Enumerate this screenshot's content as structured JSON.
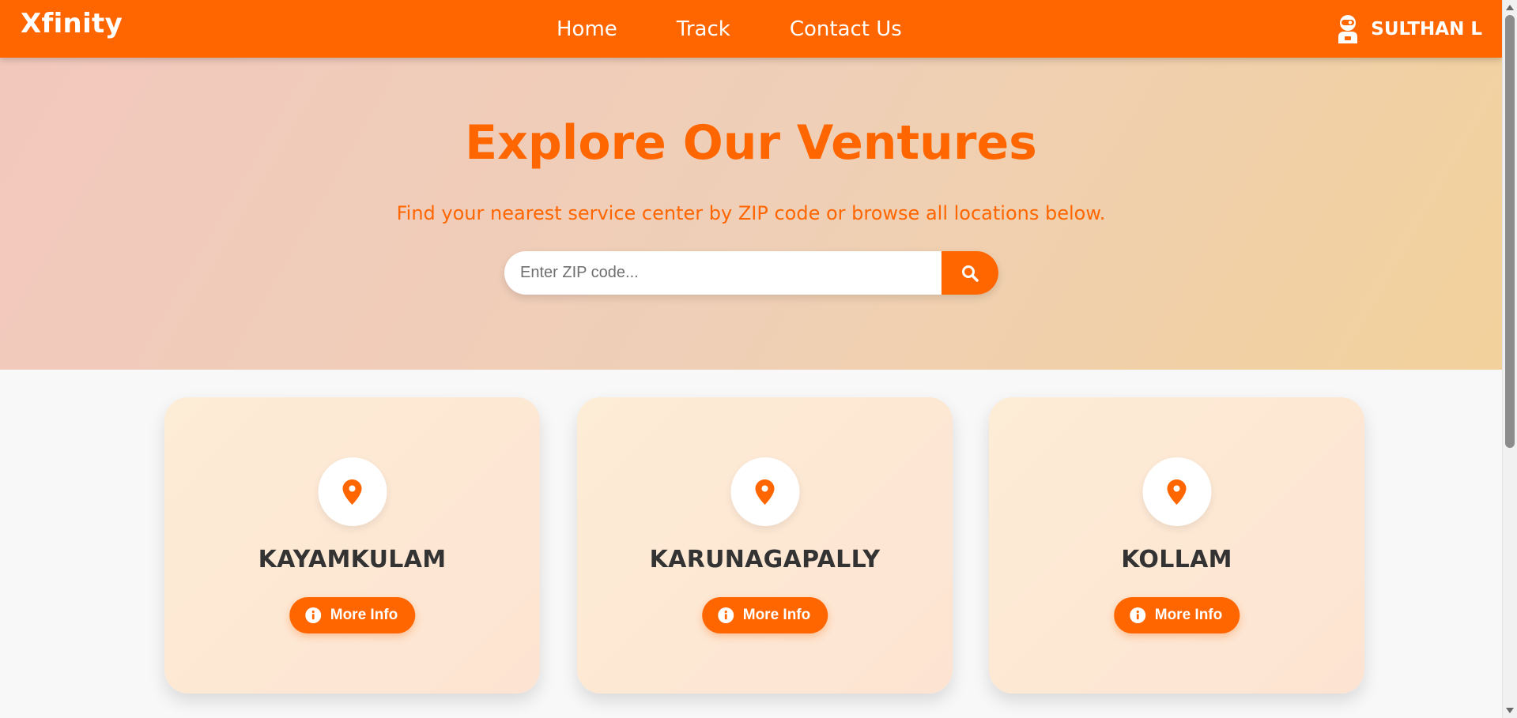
{
  "nav": {
    "brand": "Xfinity",
    "links": [
      {
        "label": "Home"
      },
      {
        "label": "Track"
      },
      {
        "label": "Contact Us"
      }
    ],
    "user": {
      "name": "SULTHAN L"
    }
  },
  "hero": {
    "title": "Explore Our Ventures",
    "subtitle": "Find your nearest service center by ZIP code or browse all locations below.",
    "search": {
      "placeholder": "Enter ZIP code...",
      "value": ""
    }
  },
  "locations": [
    {
      "name": "KAYAMKULAM",
      "button_label": "More Info"
    },
    {
      "name": "KARUNAGAPALLY",
      "button_label": "More Info"
    },
    {
      "name": "KOLLAM",
      "button_label": "More Info"
    }
  ],
  "icons": {
    "user": "user-avatar-icon",
    "search": "search-icon",
    "pin": "map-pin-icon",
    "info": "info-circle-icon"
  },
  "colors": {
    "primary": "#ff6600",
    "card_title": "#333333"
  }
}
